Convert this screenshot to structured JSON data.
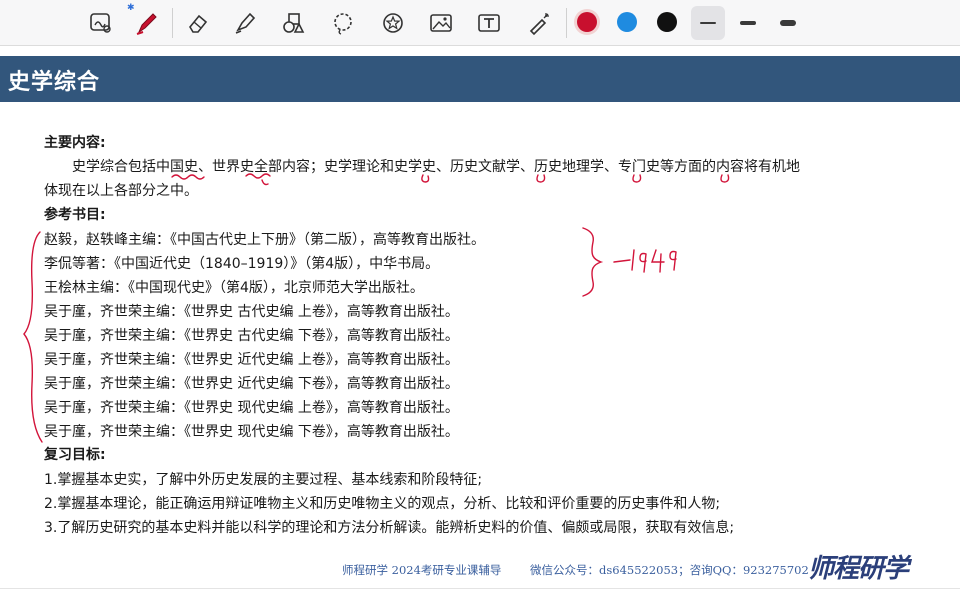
{
  "toolbar": {
    "tools": [
      "lasso-zoom-icon",
      "pen-icon",
      "eraser-icon",
      "highlighter-icon",
      "shapes-icon",
      "lasso-select-icon",
      "sticker-icon",
      "image-icon",
      "text-box-icon",
      "laser-pointer-icon"
    ],
    "bluetooth_mark": "✱",
    "colors": [
      "#c8102e",
      "#1f8be0",
      "#111111"
    ],
    "selected_color": "#c8102e"
  },
  "header": {
    "title": "史学综合"
  },
  "sections": {
    "main_content_heading": "主要内容:",
    "main_content_line1": "史学综合包括中国史、世界史全部内容；史学理论和史学史、历史文献学、历史地理学、专门史等方面的内容将有机地",
    "main_content_line2": "体现在以上各部分之中。",
    "references_heading": "参考书目:",
    "references": [
      "赵毅，赵轶峰主编：《中国古代史上下册》（第二版），高等教育出版社。",
      "李侃等著：《中国近代史（1840–1919）》（第4版），中华书局。",
      "王桧林主编：《中国现代史》（第4版），北京师范大学出版社。",
      "吴于廑，齐世荣主编：《世界史 古代史编 上卷》，高等教育出版社。",
      "吴于廑，齐世荣主编：《世界史 古代史编 下卷》，高等教育出版社。",
      "吴于廑，齐世荣主编：《世界史 近代史编 上卷》，高等教育出版社。",
      "吴于廑，齐世荣主编：《世界史 近代史编 下卷》，高等教育出版社。",
      "吴于廑，齐世荣主编：《世界史 现代史编 上卷》，高等教育出版社。",
      "吴于廑，齐世荣主编：《世界史 现代史编 下卷》，高等教育出版社。"
    ],
    "goals_heading": "复习目标:",
    "goals": [
      "1.掌握基本史实，了解中外历史发展的主要过程、基本线索和阶段特征;",
      "2.掌握基本理论，能正确运用辩证唯物主义和历史唯物主义的观点，分析、比较和评价重要的历史事件和人物;",
      "3.了解历史研究的基本史料并能以科学的理论和方法分析解读。能辨析史料的价值、偏颇或局限，获取有效信息;"
    ]
  },
  "annotation": {
    "handwritten_note": "-1949"
  },
  "footer": {
    "left_text": "师程研学 2024考研专业课辅导",
    "right_text": "微信公众号：ds645522053；咨询QQ：923275702",
    "logo_text": "师程研学"
  }
}
